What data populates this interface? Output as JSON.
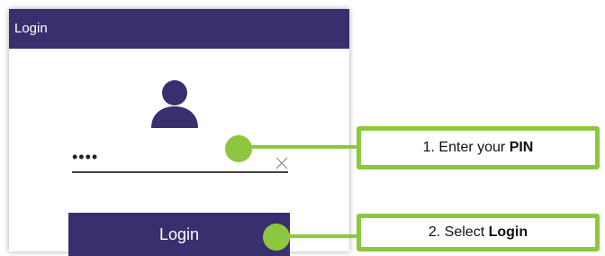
{
  "window": {
    "title": "Login"
  },
  "form": {
    "pin_value": "••••",
    "submit_label": "Login"
  },
  "icons": {
    "avatar": "user-silhouette",
    "clear": "x-close"
  },
  "callouts": [
    {
      "step": "1. Enter your ",
      "emphasis": "PIN"
    },
    {
      "step": "2. Select ",
      "emphasis": "Login"
    }
  ],
  "colors": {
    "titlebar": "#372f6e",
    "button": "#372f6e",
    "highlight": "#8dc73f"
  }
}
